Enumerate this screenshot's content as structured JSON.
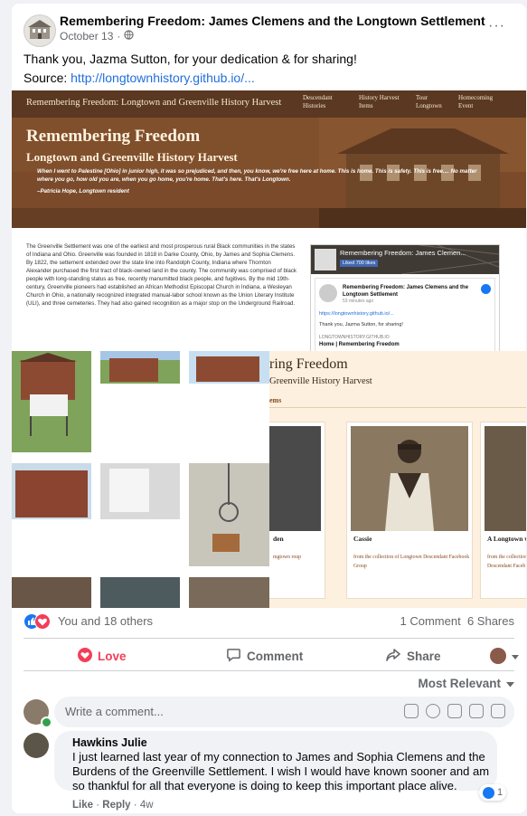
{
  "post": {
    "page_name": "Remembering Freedom: James Clemens and the Longtown Settlement",
    "date": "October 13",
    "separator": "·",
    "more": "···",
    "text": "Thank you, Jazma Sutton, for your dedication & for sharing!",
    "source_label": "Source: ",
    "source_link": "http://longtownhistory.github.io/..."
  },
  "shared_image": {
    "nav": {
      "brand": "Remembering Freedom: Longtown and Greenville History Harvest",
      "items": [
        "Descendant Histories",
        "History Harvest Items",
        "Tour Longtown",
        "Homecoming Event"
      ]
    },
    "hero": {
      "title": "Remembering Freedom",
      "subtitle": "Longtown and Greenville History Harvest",
      "quote": "When I went to Palestine [Ohio] in junior high, it was so prejudiced, and then, you know, we're free here at home. This is home. This is safety. This is free.... No matter where you go, how old you are, when you go home, you're home. That's here. That's Longtown.",
      "attribution": "–Patricia Hope, Longtown resident"
    },
    "body": "The Greenville Settlement was one of the earliest and most prosperous rural Black communities in the states of Indiana and Ohio. Greenville was founded in 1818 in Darke County, Ohio, by James and Sophia Clemens. By 1822, the settement extended over the state line into Randolph County, Indiana where Thornton Alexander purchased the first tract of black-owned land in the county. The community was comprised of black people with long-standing status as free, recently manumitted black people, and fugitives. By the mid 19th-century, Greenville pioneers had established an African Methodist Episcopal Church in Indiana, a Wesleyan Church in Ohio, a nationally recognized integrated manual-labor school known as the Union Literary Institute (ULI), and three cemeteries. They had also gained recognition as a major stop on the Underground Railroad.",
    "embed": {
      "title": "Remembering Freedom: James Clemen...",
      "liked": "Liked",
      "likes": "700 likes",
      "inner_title": "Remembering Freedom: James Clemens and the Longtown Settlement",
      "inner_time": "53 minutes ago",
      "inner_link": "https://longtownhistory.github.io/...",
      "inner_thanks": "Thank you, Jazma Sutton, for sharing!",
      "inner_domain": "LONGTOWNHISTORY.GITHUB.IO",
      "inner_home": "Home | Remembering Freedom"
    },
    "overlay": {
      "title": "ring Freedom",
      "subtitle": "Greenville History Harvest",
      "section": "ems",
      "cards": [
        {
          "name": "den",
          "source": "mgtown roup"
        },
        {
          "name": "Cassie",
          "source": "from the collection of Longtown Descendant Facebook Group"
        },
        {
          "name": "A Longtown w",
          "source": "from the collection Descendant Faceb"
        }
      ]
    }
  },
  "reactions": {
    "summary": "You and 18 others",
    "comments": "1 Comment",
    "shares": "6 Shares",
    "colors": {
      "like": "#1877f2",
      "love": "#f33e58"
    }
  },
  "actions": {
    "love": "Love",
    "comment": "Comment",
    "share": "Share"
  },
  "sort": {
    "label": "Most Relevant"
  },
  "comment_box": {
    "placeholder": "Write a comment..."
  },
  "comment": {
    "author": "Hawkins Julie",
    "text": "I just learned last year of my connection to James and Sophia Clemens and the Burdens of the Greenville Settlement. I wish I would have known sooner and am so thankful for all that everyone is doing to keep this important place alive.",
    "like": "Like",
    "reply": "Reply",
    "age": "4w",
    "reaction_count": "1",
    "dot": "·"
  }
}
